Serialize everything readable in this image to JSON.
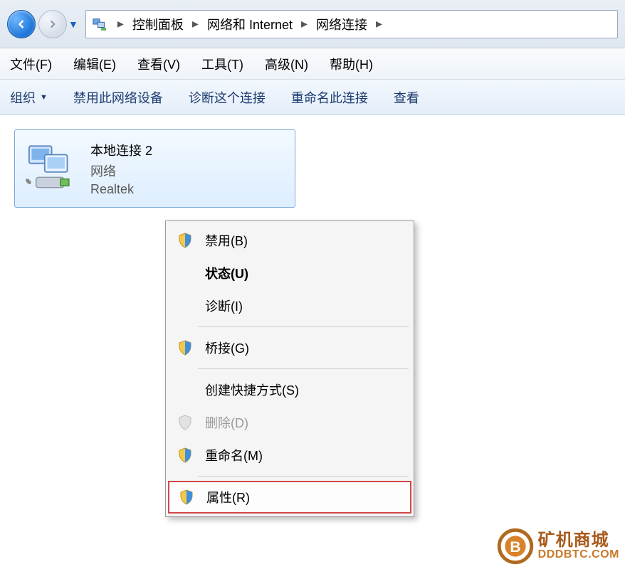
{
  "breadcrumbs": [
    "控制面板",
    "网络和 Internet",
    "网络连接"
  ],
  "menubar": [
    "文件(F)",
    "编辑(E)",
    "查看(V)",
    "工具(T)",
    "高级(N)",
    "帮助(H)"
  ],
  "toolbar": {
    "organize": "组织",
    "disable_device": "禁用此网络设备",
    "diagnose": "诊断这个连接",
    "rename": "重命名此连接",
    "view": "查看"
  },
  "connection": {
    "title": "本地连接 2",
    "network": "网络",
    "adapter": "Realtek"
  },
  "context_menu": {
    "disable": "禁用(B)",
    "status": "状态(U)",
    "diagnose": "诊断(I)",
    "bridge": "桥接(G)",
    "shortcut": "创建快捷方式(S)",
    "delete": "删除(D)",
    "rename": "重命名(M)",
    "properties": "属性(R)"
  },
  "watermark": {
    "title": "矿机商城",
    "url": "DDDBTC.COM"
  }
}
